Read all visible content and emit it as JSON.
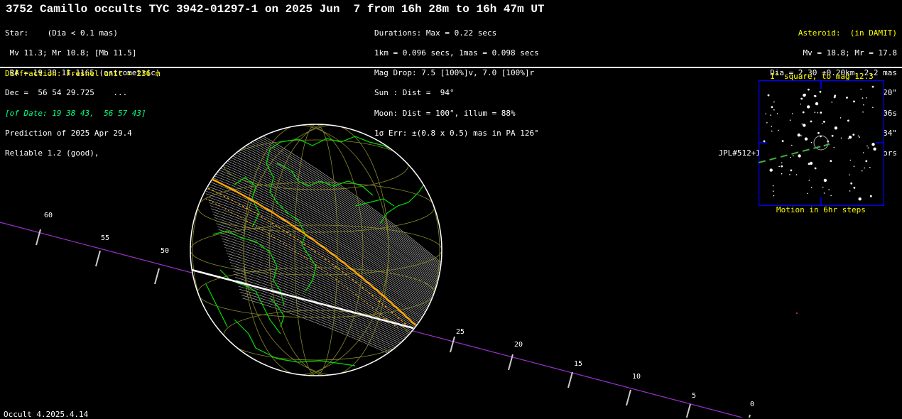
{
  "title": "3752 Camillo occults TYC 3942-01297-1 on 2025 Jun  7 from 16h 28m to 16h 47m UT",
  "star": {
    "l1": "Star:    (Dia < 0.1 mas)",
    "l2": " Mv 11.3; Mr 10.8; [Mb 11.5]",
    "l3": " RA = 19 38 11.1165 (astrometric)",
    "l4": "Dec =  56 54 29.725    ...",
    "l5": "[of Date: 19 38 43,  56 57 43]",
    "l6": "Prediction of 2025 Apr 29.4",
    "l7": "Reliable 1.2 (good),"
  },
  "event": {
    "l1": "Durations: Max = 0.22 secs",
    "l2": "1km = 0.096 secs, 1mas = 0.098 secs",
    "l3": "Mag Drop: 7.5 [100%]v, 7.0 [100%]r",
    "l4": "Sun : Dist =  94°",
    "l5": "Moon: Dist = 100°, illum = 88%",
    "l6": "1σ Err: ±(0.8 x 0.5) mas in PA 126°"
  },
  "asteroid": {
    "l1": "Asteroid:  (in DAMIT)",
    "l2": "Mv = 18.8; Mr = 17.8",
    "l3": "Dia = 2.30 ±0.20km, 2.2 mas",
    "l4": "Parallax = 6.220\"",
    "l5": "Hourly dRA =-4.306s",
    "l6": "dDec =  9.34\"",
    "l7": "JPL#512+INTG:2025-Apr-28, Known errors"
  },
  "diffraction": "Diffraction: Fresnel unit = 236 m",
  "finder": {
    "title": "1° square, to mag 12.3",
    "caption": "Motion in 6hr steps"
  },
  "footer": "Occult 4.2025.4.14",
  "time_ticks": [
    "60",
    "55",
    "50",
    "25",
    "20",
    "15",
    "10",
    "5",
    "0"
  ],
  "colors": {
    "path": "#ffa500",
    "land": "#00ff00",
    "grid": "#999933",
    "track": "#cc33ff"
  }
}
